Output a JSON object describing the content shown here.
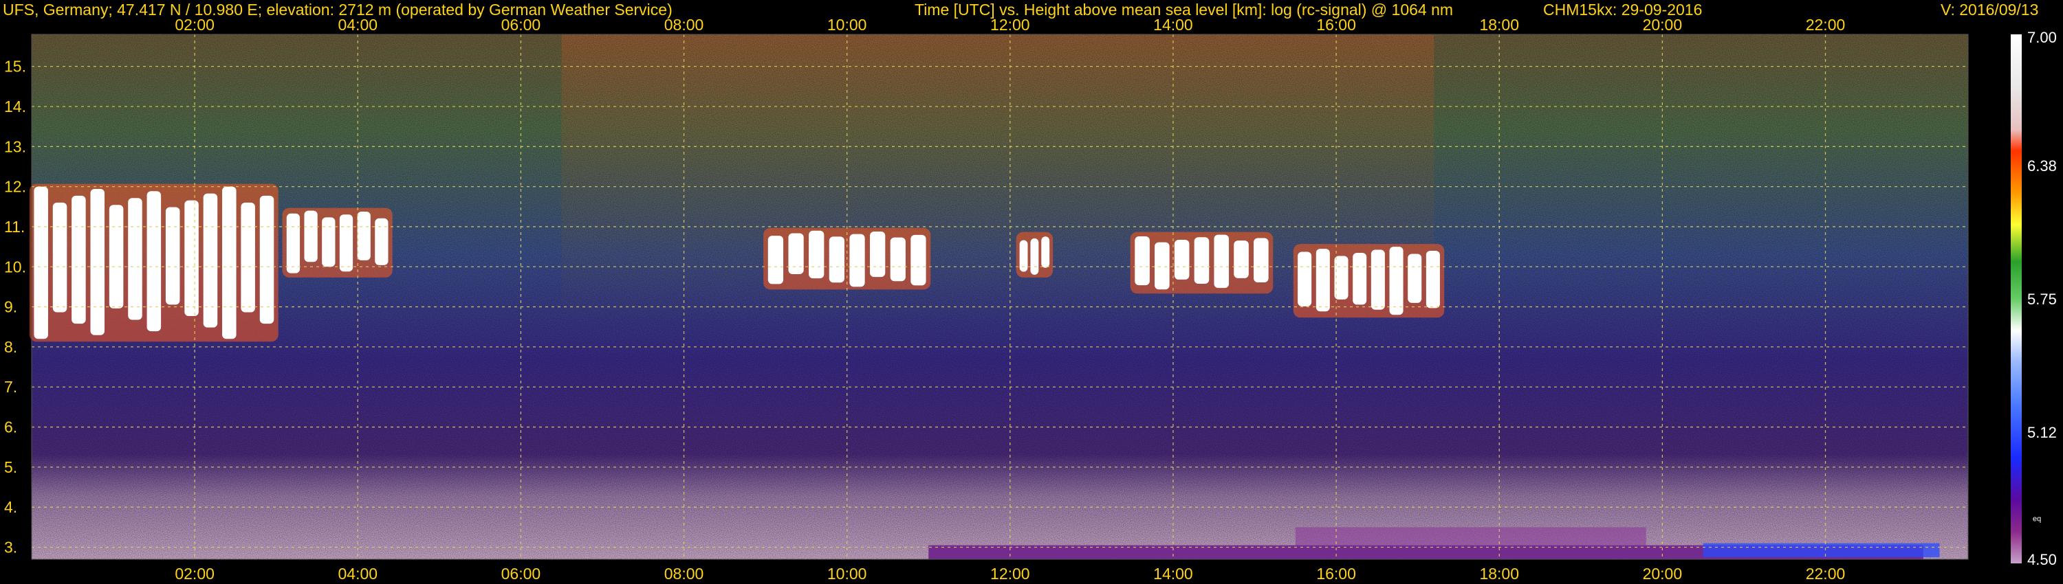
{
  "header": {
    "station": "UFS, Germany; 47.417 N / 10.980 E; elevation: 2712 m  (operated by German Weather Service)",
    "axis_description": "Time [UTC] vs. Height above mean sea level [km]: log (rc-signal) @ 1064 nm",
    "instrument_date": "CHM15kx: 29-09-2016",
    "version": "V: 2016/09/13"
  },
  "colors": {
    "background": "#000000",
    "text": "#ffd21a",
    "grid": "#e0d060",
    "colorbar_scale": [
      "#c8a2c8",
      "#8b2a8b",
      "#5a0aa0",
      "#1a2aff",
      "#4a7aff",
      "#9ab8ff",
      "#ffffff",
      "#66cc66",
      "#2aa02a",
      "#ffff33",
      "#ff9900",
      "#ff3300",
      "#e8c0c0",
      "#ffffff"
    ]
  },
  "chart_data": {
    "type": "heatmap",
    "title": "Time [UTC] vs. Height above mean sea level [km]: log (rc-signal) @ 1064 nm",
    "xlabel": "Time [UTC]",
    "ylabel": "Height above mean sea level [km]",
    "x_range_hours": [
      0,
      23.75
    ],
    "y_range_km": [
      2.7,
      15.8
    ],
    "x_ticks": [
      "02:00",
      "04:00",
      "06:00",
      "08:00",
      "10:00",
      "12:00",
      "14:00",
      "16:00",
      "18:00",
      "20:00",
      "22:00"
    ],
    "x_tick_hours": [
      2,
      4,
      6,
      8,
      10,
      12,
      14,
      16,
      18,
      20,
      22
    ],
    "y_ticks": [
      "3.",
      "4.",
      "5.",
      "6.",
      "7.",
      "8.",
      "9.",
      "10.",
      "11.",
      "12.",
      "13.",
      "14.",
      "15."
    ],
    "y_tick_values": [
      3,
      4,
      5,
      6,
      7,
      8,
      9,
      10,
      11,
      12,
      13,
      14,
      15
    ],
    "grid": true,
    "colorbar": {
      "min": 4.5,
      "max": 7.0,
      "tick_labels": [
        "7.00",
        "6.38",
        "5.75",
        "5.12",
        "4.50"
      ],
      "tick_values": [
        7.0,
        6.38,
        5.75,
        5.12,
        4.5
      ],
      "small_label": "eq"
    },
    "cloud_features": [
      {
        "start_hour": 0.0,
        "end_hour": 3.0,
        "base_km": 8.2,
        "top_km": 12.0
      },
      {
        "start_hour": 3.1,
        "end_hour": 4.4,
        "base_km": 9.8,
        "top_km": 11.4
      },
      {
        "start_hour": 9.0,
        "end_hour": 11.0,
        "base_km": 9.5,
        "top_km": 10.9
      },
      {
        "start_hour": 12.1,
        "end_hour": 12.5,
        "base_km": 9.8,
        "top_km": 10.8
      },
      {
        "start_hour": 13.5,
        "end_hour": 15.2,
        "base_km": 9.4,
        "top_km": 10.8
      },
      {
        "start_hour": 15.5,
        "end_hour": 17.3,
        "base_km": 8.8,
        "top_km": 10.5
      }
    ]
  }
}
